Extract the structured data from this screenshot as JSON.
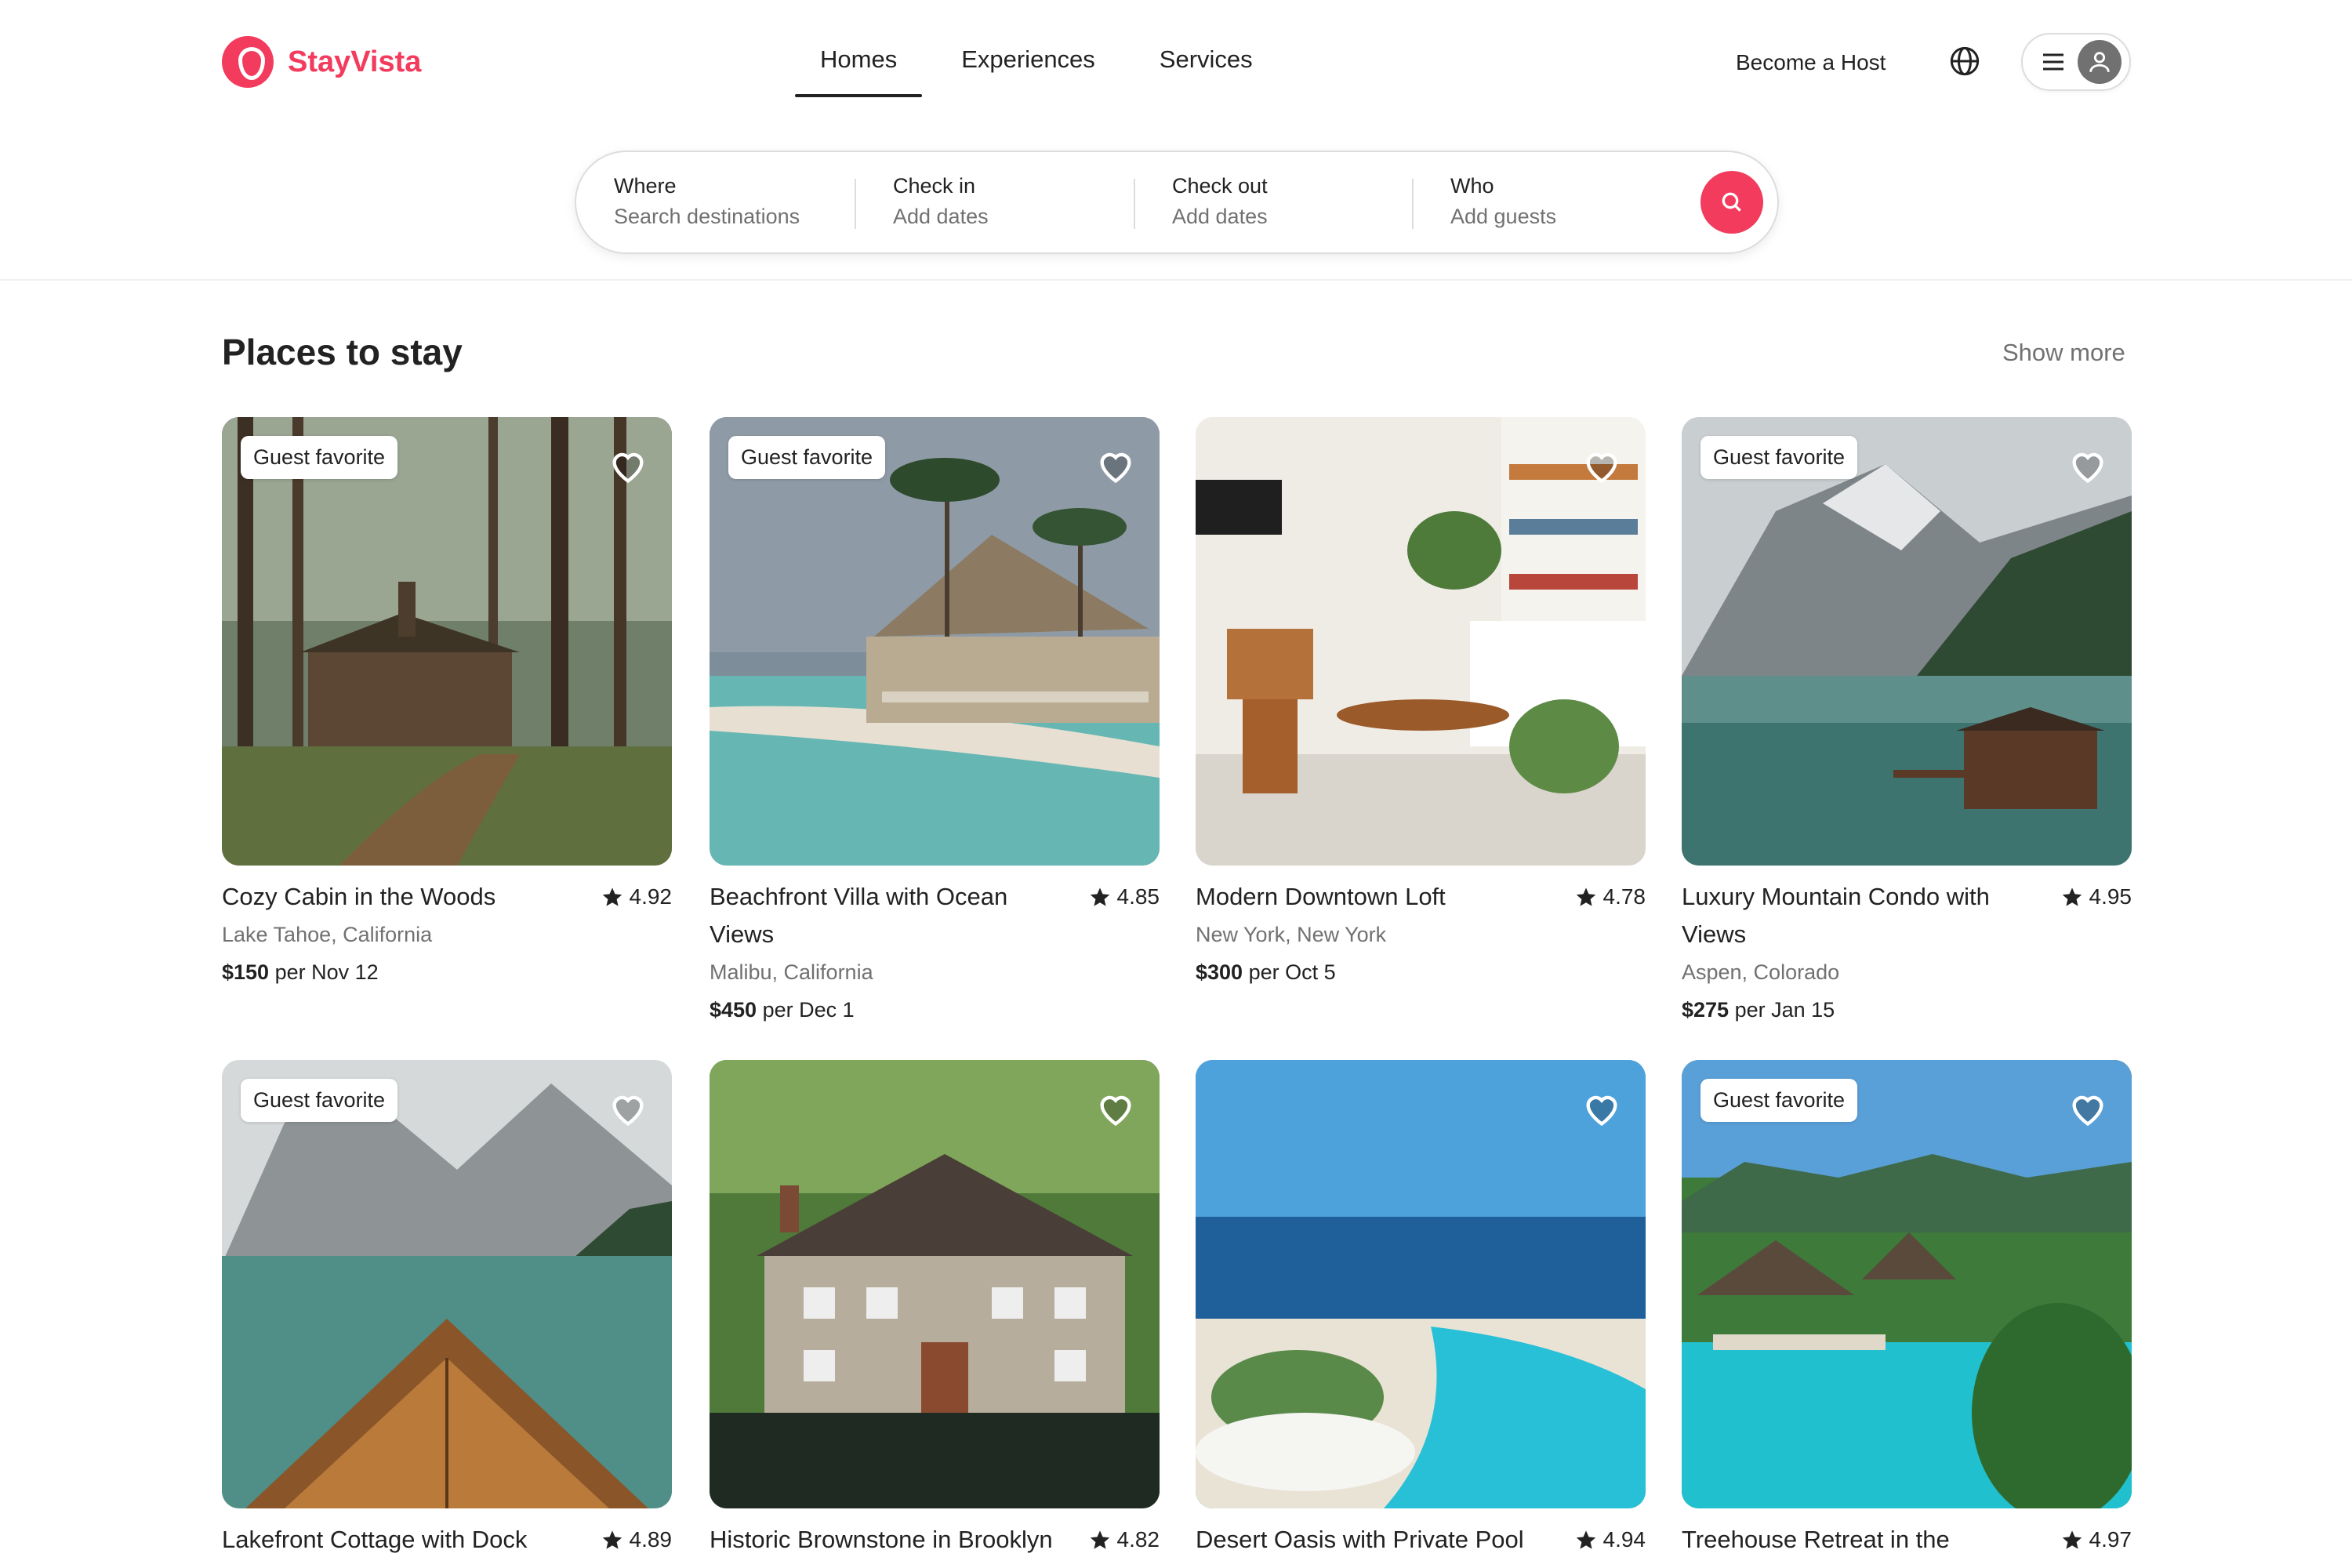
{
  "brand": {
    "name": "StayVista",
    "color": "#f23b5d"
  },
  "nav": {
    "tabs": [
      {
        "label": "Homes",
        "active": true
      },
      {
        "label": "Experiences",
        "active": false
      },
      {
        "label": "Services",
        "active": false
      }
    ],
    "host_link": "Become a Host",
    "globe_icon": "globe-icon",
    "menu_icon": "hamburger-menu-icon",
    "avatar_icon": "user-avatar-icon"
  },
  "search": {
    "where": {
      "label": "Where",
      "placeholder": "Search destinations"
    },
    "check_in": {
      "label": "Check in",
      "placeholder": "Add dates"
    },
    "check_out": {
      "label": "Check out",
      "placeholder": "Add dates"
    },
    "who": {
      "label": "Who",
      "placeholder": "Add guests"
    },
    "button_icon": "search-icon"
  },
  "section": {
    "title": "Places to stay",
    "show_more": "Show more"
  },
  "listings": [
    {
      "title": "Cozy Cabin in the Woods",
      "location": "Lake Tahoe, California",
      "price": "$150",
      "per": "per Nov 12",
      "rating": "4.92",
      "badge": "Guest favorite"
    },
    {
      "title": "Beachfront Villa with Ocean Views",
      "location": "Malibu, California",
      "price": "$450",
      "per": "per Dec 1",
      "rating": "4.85",
      "badge": "Guest favorite"
    },
    {
      "title": "Modern Downtown Loft",
      "location": "New York, New York",
      "price": "$300",
      "per": "per Oct 5",
      "rating": "4.78",
      "badge": ""
    },
    {
      "title": "Luxury Mountain Condo with Views",
      "location": "Aspen, Colorado",
      "price": "$275",
      "per": "per Jan 15",
      "rating": "4.95",
      "badge": "Guest favorite"
    },
    {
      "title": "Lakefront Cottage with Dock",
      "rating": "4.89",
      "badge": "Guest favorite"
    },
    {
      "title": "Historic Brownstone in Brooklyn",
      "rating": "4.82",
      "badge": ""
    },
    {
      "title": "Desert Oasis with Private Pool",
      "rating": "4.94",
      "badge": ""
    },
    {
      "title": "Treehouse Retreat in the",
      "rating": "4.97",
      "badge": "Guest favorite"
    }
  ]
}
